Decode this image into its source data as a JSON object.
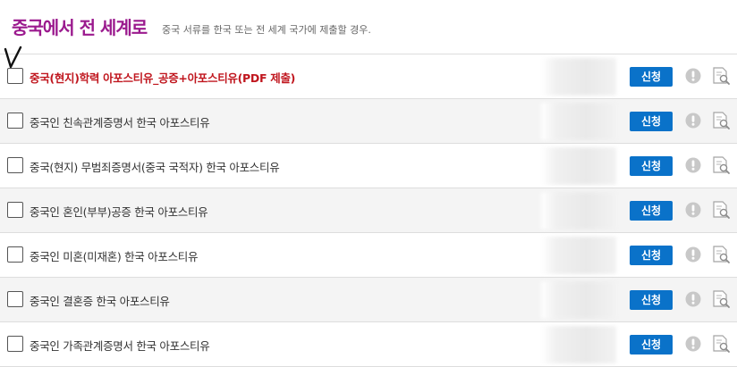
{
  "header": {
    "title": "중국에서 전 세계로",
    "subtitle": "중국 서류를 한국 또는 전 세계 국가에 제출할 경우."
  },
  "rows": [
    {
      "label": "중국(현지)학력 아포스티유_공증+아포스티유(PDF 제출)",
      "button": "신청",
      "checked": true,
      "highlight": true
    },
    {
      "label": "중국인 친속관계증명서 한국 아포스티유",
      "button": "신청",
      "checked": false,
      "highlight": false
    },
    {
      "label": "중국(현지) 무범죄증명서(중국 국적자) 한국 아포스티유",
      "button": "신청",
      "checked": false,
      "highlight": false
    },
    {
      "label": "중국인 혼인(부부)공증 한국 아포스티유",
      "button": "신청",
      "checked": false,
      "highlight": false
    },
    {
      "label": "중국인 미혼(미재혼) 한국 아포스티유",
      "button": "신청",
      "checked": false,
      "highlight": false
    },
    {
      "label": "중국인 결혼증 한국 아포스티유",
      "button": "신청",
      "checked": false,
      "highlight": false
    },
    {
      "label": "중국인 가족관계증명서 한국 아포스티유",
      "button": "신청",
      "checked": false,
      "highlight": false
    }
  ],
  "colors": {
    "title": "#9b1a8e",
    "highlight_text": "#c0161e",
    "button_bg": "#0a72c9",
    "icon_gray": "#c8c8c8",
    "row_alt_bg": "#f4f4f4"
  },
  "icons": {
    "check": "handwritten-check-icon",
    "info": "exclamation-circle-icon",
    "preview": "document-magnifier-icon"
  }
}
